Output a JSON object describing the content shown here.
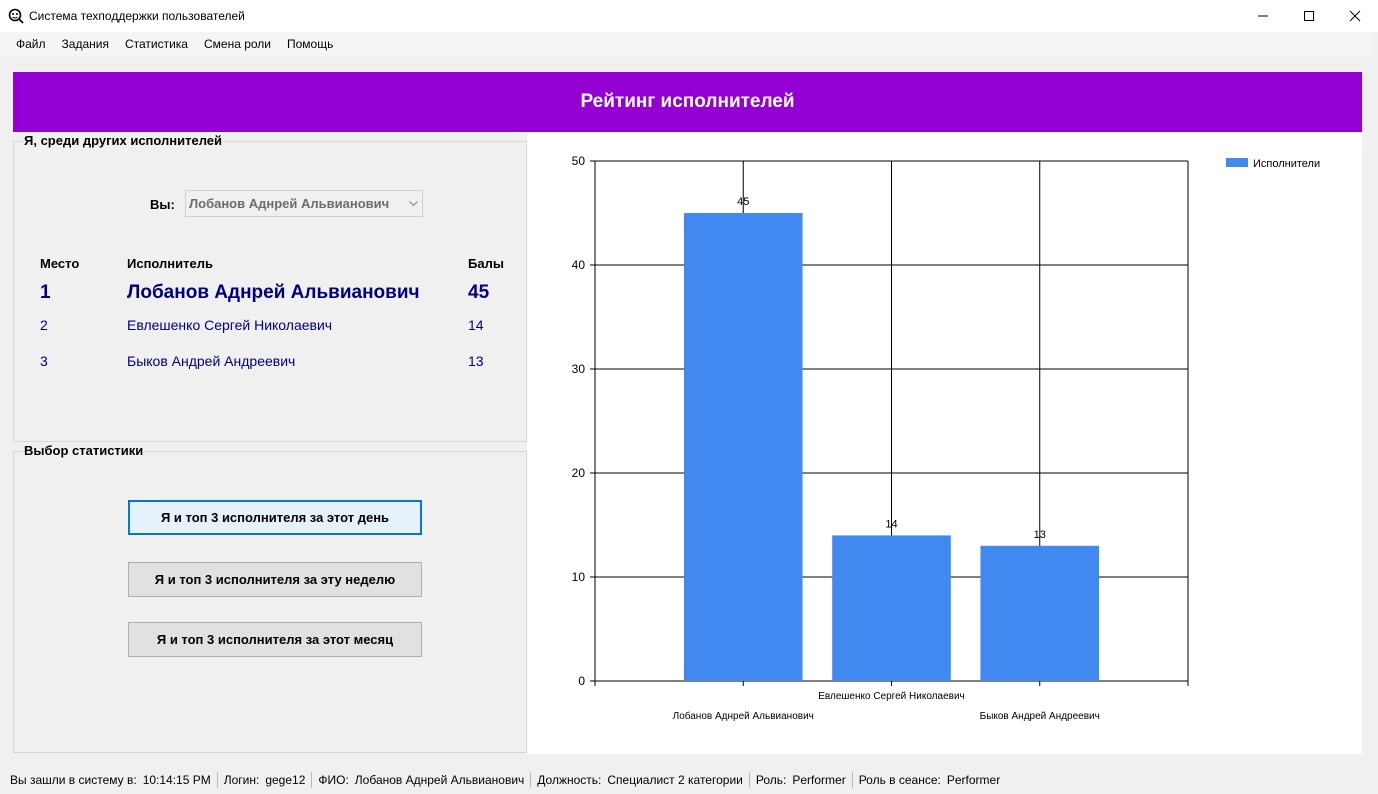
{
  "window": {
    "title": "Система техподдержки пользователей"
  },
  "menu": [
    "Файл",
    "Задания",
    "Статистика",
    "Смена роли",
    "Помощь"
  ],
  "header": {
    "title": "Рейтинг исполнителей"
  },
  "rating_group": {
    "legend": "Я, среди других исполнителей",
    "you_label": "Вы:",
    "you_value": "Лобанов Аднрей Альвианович",
    "headers": {
      "place": "Место",
      "performer": "Исполнитель",
      "points": "Балы"
    },
    "rows": [
      {
        "place": "1",
        "name": "Лобанов Аднрей Альвианович",
        "points": "45"
      },
      {
        "place": "2",
        "name": "Евлешенко Сергей Николаевич",
        "points": "14"
      },
      {
        "place": "3",
        "name": "Быков Андрей Андреевич",
        "points": "13"
      }
    ]
  },
  "stats_group": {
    "legend": "Выбор статистики",
    "buttons": [
      "Я и топ 3 исполнителя за этот день",
      "Я и топ 3 исполнителя за эту неделю",
      "Я и топ 3 исполнителя за этот месяц"
    ]
  },
  "chart_data": {
    "type": "bar",
    "categories": [
      "Лобанов Аднрей Альвианович",
      "Евлешенко Сергей Николаевич",
      "Быков Андрей Андреевич"
    ],
    "series": [
      {
        "name": "Исполнители",
        "values": [
          45,
          14,
          13
        ],
        "color": "#4189f0"
      }
    ],
    "ylim": [
      0,
      50
    ],
    "yticks": [
      0,
      10,
      20,
      30,
      40,
      50
    ],
    "grid": true,
    "legend_position": "top-right",
    "data_labels": true
  },
  "status": {
    "login_time_label": "Вы зашли в систему в:",
    "login_time": "10:14:15 PM",
    "login_label": "Логин:",
    "login": "gege12",
    "fio_label": "ФИО:",
    "fio": "Лобанов Аднрей Альвианович",
    "position_label": "Должность:",
    "position": "Специалист 2 категории",
    "role_label": "Роль:",
    "role": "Performer",
    "session_role_label": "Роль в сеансе:",
    "session_role": "Performer"
  },
  "colors": {
    "header_bg": "#9400d3",
    "row_text": "#000080",
    "bar": "#4189f0",
    "focus": "#0078d7"
  }
}
